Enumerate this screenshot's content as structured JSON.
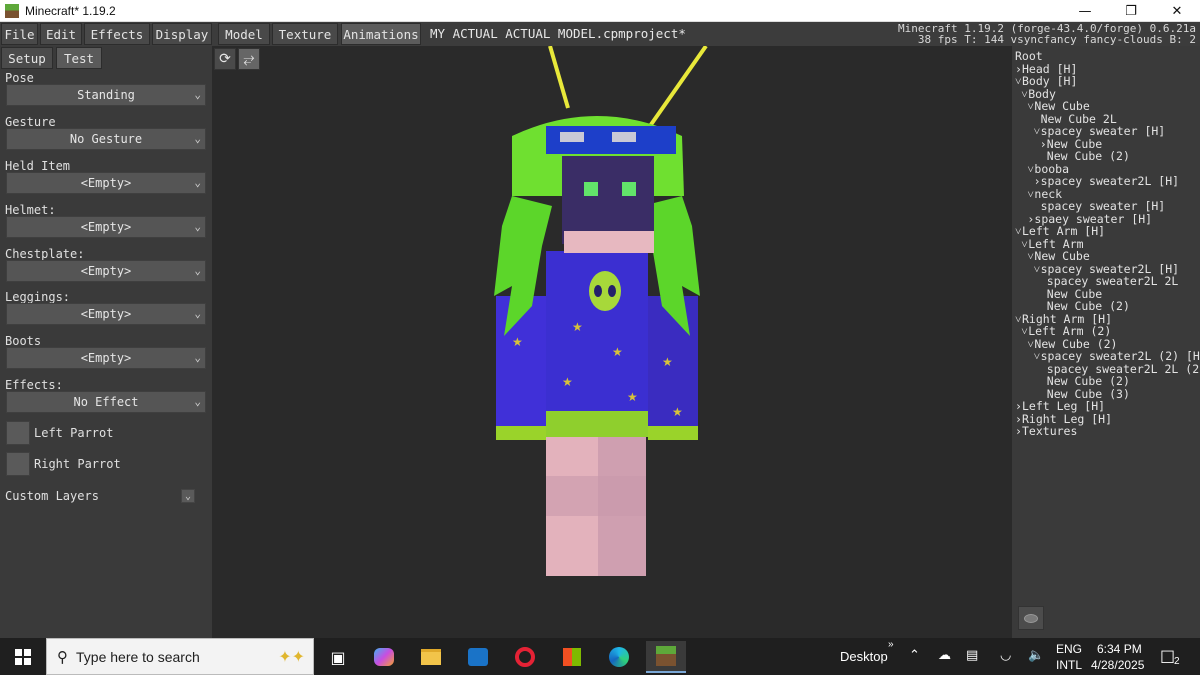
{
  "window": {
    "title": "Minecraft* 1.19.2",
    "controls": [
      "minimize",
      "maximize",
      "close"
    ]
  },
  "menubar": {
    "items": [
      "File",
      "Edit",
      "Effects",
      "Display",
      "Model",
      "Texture",
      "Animations"
    ],
    "active": "Animations",
    "project_title": "MY ACTUAL ACTUAL MODEL.cpmproject*",
    "version_line1": "Minecraft 1.19.2 (forge-43.4.0/forge) 0.6.21a",
    "version_line2": "38 fps T: 144 vsyncfancy fancy-clouds B: 2"
  },
  "left_panel": {
    "tabs": [
      "Setup",
      "Test"
    ],
    "active_tab": "Test",
    "fields": [
      {
        "label": "Pose",
        "value": "Standing"
      },
      {
        "label": "Gesture",
        "value": "No Gesture"
      },
      {
        "label": "Held Item",
        "value": "<Empty>"
      },
      {
        "label": "Helmet:",
        "value": "<Empty>"
      },
      {
        "label": "Chestplate:",
        "value": "<Empty>"
      },
      {
        "label": "Leggings:",
        "value": "<Empty>"
      },
      {
        "label": "Boots",
        "value": "<Empty>"
      },
      {
        "label": "Effects:",
        "value": "No Effect"
      }
    ],
    "checkboxes": [
      {
        "label": "Left Parrot",
        "checked": false
      },
      {
        "label": "Right Parrot",
        "checked": false
      }
    ],
    "custom_layers_label": "Custom Layers"
  },
  "viewport": {
    "tools": [
      "rotate-icon",
      "pan-icon"
    ],
    "colors": {
      "hair": "#5cd62a",
      "sweater": "#3b2fd1",
      "skin": "#e7b8c0",
      "star": "#d7c23a"
    }
  },
  "tree": {
    "items": [
      {
        "label": "Root",
        "depth": 0,
        "arrow": ""
      },
      {
        "label": "Head [H]",
        "depth": 0,
        "arrow": ">"
      },
      {
        "label": "Body [H]",
        "depth": 0,
        "arrow": "v"
      },
      {
        "label": "Body",
        "depth": 1,
        "arrow": "v"
      },
      {
        "label": "New Cube",
        "depth": 2,
        "arrow": "v"
      },
      {
        "label": "New Cube 2L",
        "depth": 3,
        "arrow": ""
      },
      {
        "label": "spacey sweater [H]",
        "depth": 3,
        "arrow": "v"
      },
      {
        "label": "New Cube",
        "depth": 4,
        "arrow": ">"
      },
      {
        "label": "New Cube (2)",
        "depth": 4,
        "arrow": ""
      },
      {
        "label": "booba",
        "depth": 2,
        "arrow": "v"
      },
      {
        "label": "spacey sweater2L [H]",
        "depth": 3,
        "arrow": ">"
      },
      {
        "label": "neck",
        "depth": 2,
        "arrow": "v"
      },
      {
        "label": "spacey sweater [H]",
        "depth": 3,
        "arrow": ""
      },
      {
        "label": "spaey sweater [H]",
        "depth": 2,
        "arrow": ">"
      },
      {
        "label": "Left Arm [H]",
        "depth": 0,
        "arrow": "v"
      },
      {
        "label": "Left Arm",
        "depth": 1,
        "arrow": "v"
      },
      {
        "label": "New Cube",
        "depth": 2,
        "arrow": "v"
      },
      {
        "label": "spacey sweater2L [H]",
        "depth": 3,
        "arrow": "v"
      },
      {
        "label": "spacey sweater2L 2L",
        "depth": 4,
        "arrow": ""
      },
      {
        "label": "New Cube",
        "depth": 4,
        "arrow": ""
      },
      {
        "label": "New Cube (2)",
        "depth": 4,
        "arrow": ""
      },
      {
        "label": "Right Arm [H]",
        "depth": 0,
        "arrow": "v"
      },
      {
        "label": "Left Arm (2)",
        "depth": 1,
        "arrow": "v"
      },
      {
        "label": "New Cube (2)",
        "depth": 2,
        "arrow": "v"
      },
      {
        "label": "spacey sweater2L (2) [H]",
        "depth": 3,
        "arrow": "v"
      },
      {
        "label": "spacey sweater2L 2L (2)",
        "depth": 4,
        "arrow": ""
      },
      {
        "label": "New Cube (2)",
        "depth": 4,
        "arrow": ""
      },
      {
        "label": "New Cube (3)",
        "depth": 4,
        "arrow": ""
      },
      {
        "label": "Left Leg [H]",
        "depth": 0,
        "arrow": ">"
      },
      {
        "label": "Right Leg [H]",
        "depth": 0,
        "arrow": ">"
      },
      {
        "label": "Textures",
        "depth": 0,
        "arrow": ">"
      }
    ]
  },
  "taskbar": {
    "search_placeholder": "Type here to search",
    "apps": [
      "task-view-icon",
      "copilot-icon",
      "file-explorer-icon",
      "outlook-icon",
      "opera-icon",
      "store-icon",
      "edge-icon",
      "minecraft-icon"
    ],
    "desktop_label": "Desktop",
    "language_1": "ENG",
    "language_2": "INTL",
    "time": "6:34 PM",
    "date": "4/28/2025",
    "notification_count": "2"
  }
}
